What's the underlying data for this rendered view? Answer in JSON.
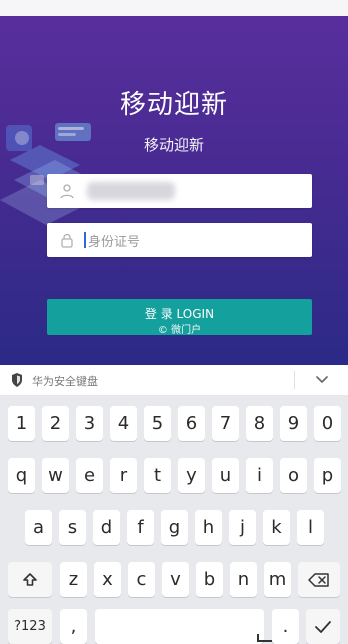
{
  "hero": {
    "title": "移动迎新",
    "subtitle": "移动迎新"
  },
  "form": {
    "username": {
      "value": ""
    },
    "idcard": {
      "placeholder": "身份证号"
    },
    "login_label": "登 录 LOGIN",
    "login_sub": "© 微门户"
  },
  "keyboard_bar": {
    "label": "华为安全键盘"
  },
  "keyboard": {
    "row1": [
      "1",
      "2",
      "3",
      "4",
      "5",
      "6",
      "7",
      "8",
      "9",
      "0"
    ],
    "row2": [
      "q",
      "w",
      "e",
      "r",
      "t",
      "y",
      "u",
      "i",
      "o",
      "p"
    ],
    "row3": [
      "a",
      "s",
      "d",
      "f",
      "g",
      "h",
      "j",
      "k",
      "l"
    ],
    "row4": [
      "z",
      "x",
      "c",
      "v",
      "b",
      "n",
      "m"
    ],
    "bottom": {
      "symbols": "?123",
      "comma": ",",
      "period": "."
    }
  },
  "colors": {
    "primary": "#4a2b93",
    "login": "#14a09c"
  },
  "icons": [
    "user-icon",
    "lock-icon",
    "shield-icon",
    "chevron-down-icon",
    "shift-icon",
    "backspace-icon",
    "checkmark-icon",
    "space-icon"
  ]
}
